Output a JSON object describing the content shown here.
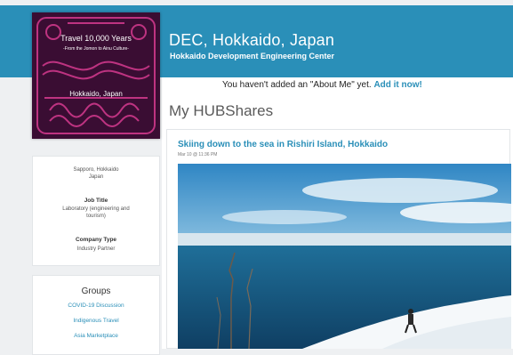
{
  "header": {
    "title": "DEC, Hokkaido, Japan",
    "subtitle": "Hokkaido Development Engineering Center"
  },
  "about_me": {
    "message": "You haven't added an \"About Me\" yet.",
    "link_label": "Add it now!"
  },
  "profile_cover": {
    "line1": "Travel 10,000 Years",
    "line2": "-From the Jomon to Ainu Culture-",
    "line3": "Hokkaido, Japan"
  },
  "info": {
    "location_line1": "Sapporo, Hokkaido",
    "location_line2": "Japan",
    "job_title_label": "Job Title",
    "job_title_line1": "Laboratory (engineering and",
    "job_title_line2": "tourism)",
    "company_type_label": "Company Type",
    "company_type_value": "Industry Partner"
  },
  "groups": {
    "title": "Groups",
    "items": [
      "COVID-19 Discussion",
      "Indigenous Travel",
      "Asia Marketplace"
    ]
  },
  "hubshares": {
    "title": "My HUBShares",
    "post": {
      "title": "Skiing down to the sea in Rishiri Island, Hokkaido",
      "date": "Mar 10 @ 11:36 PM"
    }
  },
  "colors": {
    "accent": "#2a8fb8",
    "cover_bg": "#3a0d33",
    "cover_pattern": "#d63a8f"
  }
}
